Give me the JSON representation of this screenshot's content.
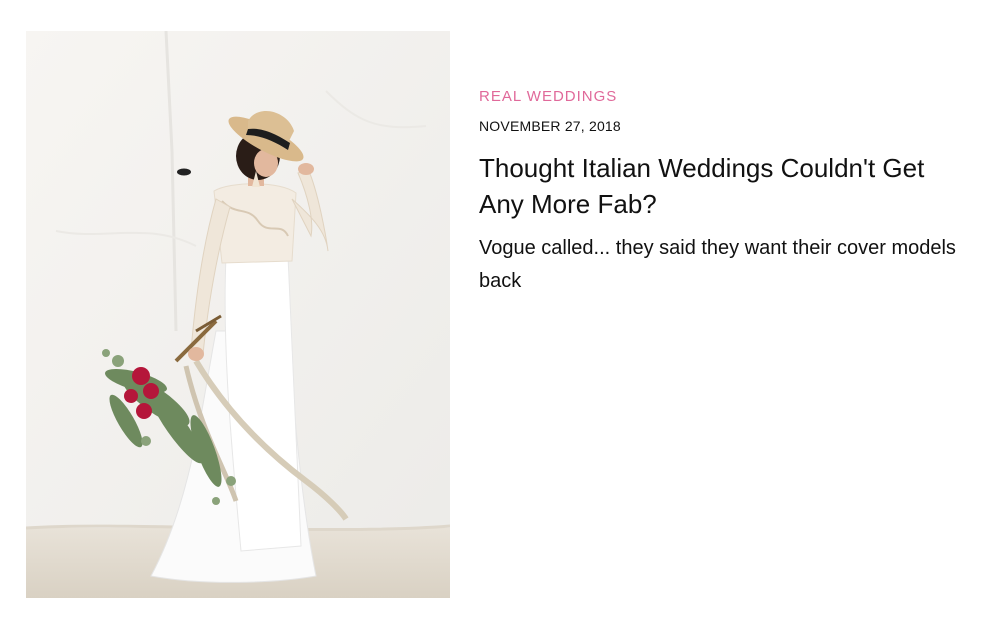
{
  "post": {
    "category": "REAL WEDDINGS",
    "date": "NOVEMBER 27, 2018",
    "title": "Thought Italian Weddings Couldn't Get Any More Fab?",
    "excerpt": "Vogue called... they said they want their cover models back",
    "image_icon": "bride-with-bouquet-photo"
  },
  "colors": {
    "category": "#e0699a",
    "text": "#111111",
    "background": "#ffffff"
  }
}
